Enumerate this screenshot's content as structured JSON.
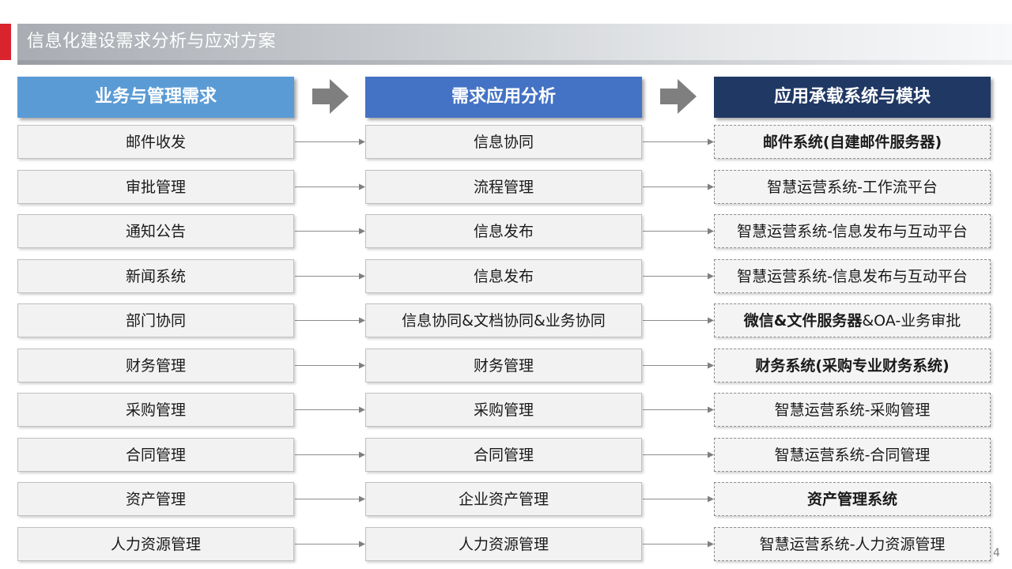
{
  "title": "信息化建设需求分析与应对方案",
  "columns": {
    "business": "业务与管理需求",
    "analysis": "需求应用分析",
    "systems": "应用承载系统与模块"
  },
  "rows": [
    {
      "business": "邮件收发",
      "analysis": "信息协同",
      "system": [
        {
          "t": "邮件系统(自建邮件服务器)",
          "b": true
        }
      ]
    },
    {
      "business": "审批管理",
      "analysis": "流程管理",
      "system": [
        {
          "t": "智慧运营系统-工作流平台",
          "b": false
        }
      ]
    },
    {
      "business": "通知公告",
      "analysis": "信息发布",
      "system": [
        {
          "t": "智慧运营系统-信息发布与互动平台",
          "b": false
        }
      ]
    },
    {
      "business": "新闻系统",
      "analysis": "信息发布",
      "system": [
        {
          "t": "智慧运营系统-信息发布与互动平台",
          "b": false
        }
      ]
    },
    {
      "business": "部门协同",
      "analysis": "信息协同&文档协同&业务协同",
      "system": [
        {
          "t": "微信&文件服务器",
          "b": true
        },
        {
          "t": "&OA-业务审批",
          "b": false
        }
      ]
    },
    {
      "business": "财务管理",
      "analysis": "财务管理",
      "system": [
        {
          "t": "财务系统(采购专业财务系统)",
          "b": true
        }
      ]
    },
    {
      "business": "采购管理",
      "analysis": "采购管理",
      "system": [
        {
          "t": "智慧运营系统-采购管理",
          "b": false
        }
      ]
    },
    {
      "business": "合同管理",
      "analysis": "合同管理",
      "system": [
        {
          "t": "智慧运营系统-合同管理",
          "b": false
        }
      ]
    },
    {
      "business": "资产管理",
      "analysis": "企业资产管理",
      "system": [
        {
          "t": "资产管理系统",
          "b": true
        }
      ]
    },
    {
      "business": "人力资源管理",
      "analysis": "人力资源管理",
      "system": [
        {
          "t": "智慧运营系统-人力资源管理",
          "b": false
        }
      ]
    }
  ],
  "page_number": "4",
  "colors": {
    "accent_red": "#d9232d",
    "header_1": "#5b9bd5",
    "header_2": "#4472c4",
    "header_3": "#203864",
    "arrow_gray": "#7f7f7f"
  }
}
